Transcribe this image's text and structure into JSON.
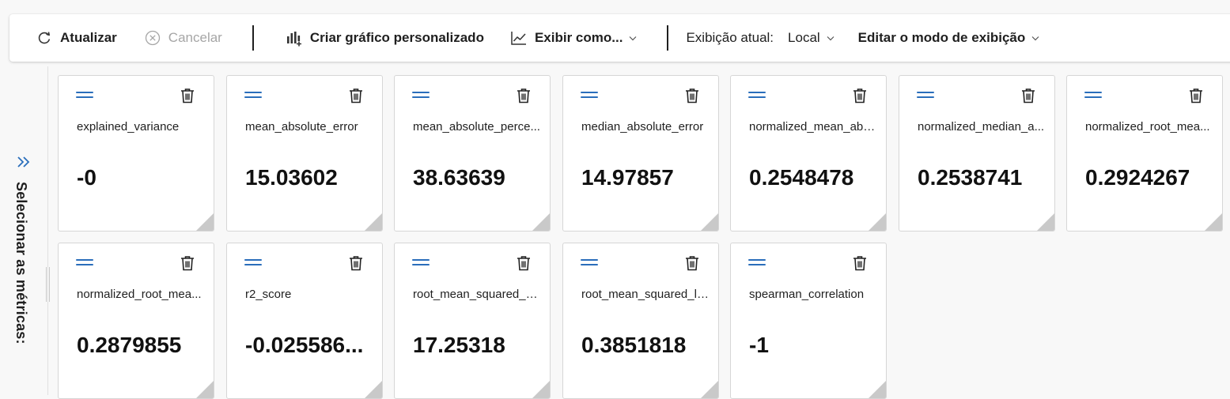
{
  "toolbar": {
    "refresh_label": "Atualizar",
    "cancel_label": "Cancelar",
    "custom_chart_label": "Criar gráfico personalizado",
    "view_as_label": "Exibir como...",
    "current_view_label": "Exibição atual:",
    "current_view_value": "Local",
    "edit_view_label": "Editar o modo de exibição"
  },
  "sidebar": {
    "label": "Selecionar as métricas:"
  },
  "colors": {
    "accent": "#2a6ebb",
    "disabled": "#a6a6a6"
  },
  "metrics": [
    {
      "name": "explained_variance",
      "value": "-0"
    },
    {
      "name": "mean_absolute_error",
      "value": "15.03602"
    },
    {
      "name": "mean_absolute_perce...",
      "value": "38.63639"
    },
    {
      "name": "median_absolute_error",
      "value": "14.97857"
    },
    {
      "name": "normalized_mean_abs...",
      "value": "0.2548478"
    },
    {
      "name": "normalized_median_a...",
      "value": "0.2538741"
    },
    {
      "name": "normalized_root_mea...",
      "value": "0.2924267"
    },
    {
      "name": "normalized_root_mea...",
      "value": "0.2879855"
    },
    {
      "name": "r2_score",
      "value": "-0.025586..."
    },
    {
      "name": "root_mean_squared_er...",
      "value": "17.25318"
    },
    {
      "name": "root_mean_squared_lo...",
      "value": "0.3851818"
    },
    {
      "name": "spearman_correlation",
      "value": "-1"
    }
  ]
}
